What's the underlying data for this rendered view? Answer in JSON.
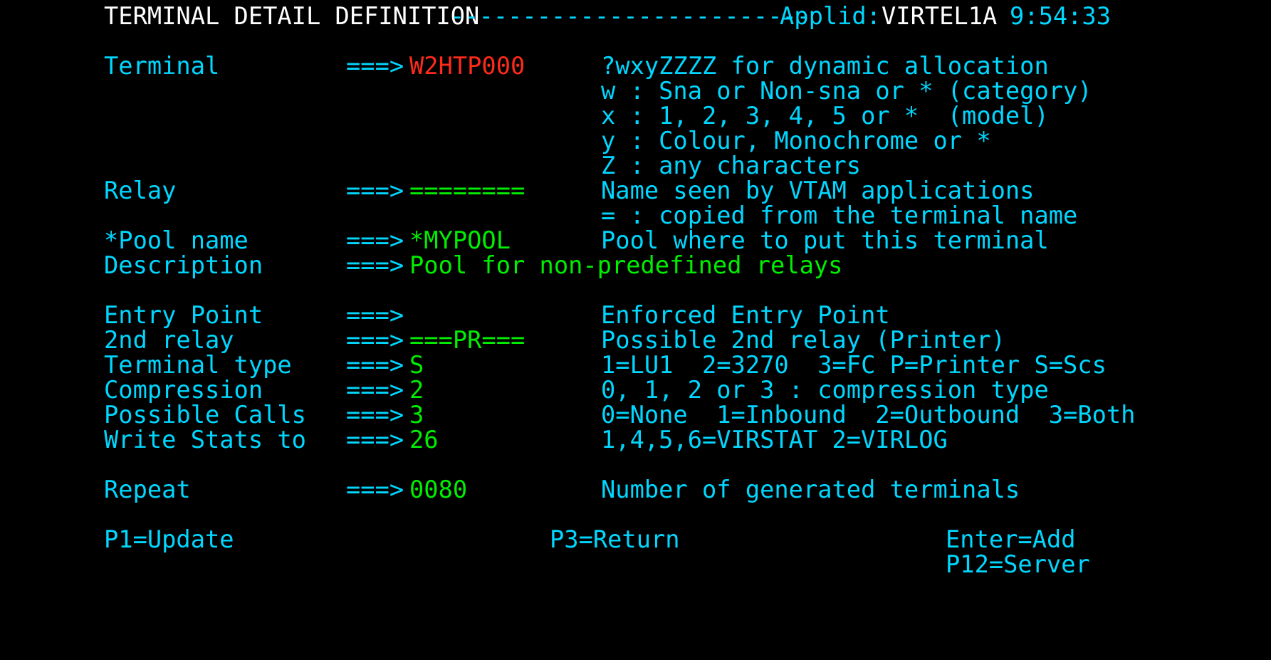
{
  "header": {
    "title": "TERMINAL DETAIL DEFINITION",
    "dashes": "-------------------------",
    "applid_label": "Applid:",
    "applid_value": "VIRTEL1A",
    "time": "9:54:33"
  },
  "arrow": "===>",
  "fields": {
    "terminal": {
      "label": "Terminal",
      "value": "W2HTP000",
      "help": [
        "?wxyZZZZ for dynamic allocation",
        "w : Sna or Non-sna or * (category)",
        "x : 1, 2, 3, 4, 5 or *  (model)",
        "y : Colour, Monochrome or *",
        "Z : any characters"
      ]
    },
    "relay": {
      "label": "Relay",
      "value": "========",
      "help": [
        "Name seen by VTAM applications",
        "= : copied from the terminal name"
      ]
    },
    "pool_name": {
      "label": "*Pool name",
      "value": "*MYPOOL",
      "help": "Pool where to put this terminal"
    },
    "description": {
      "label": "Description",
      "value": "Pool for non-predefined relays"
    },
    "entry_point": {
      "label": "Entry Point",
      "value": "",
      "help": "Enforced Entry Point"
    },
    "second_relay": {
      "label": "2nd relay",
      "value": "===PR===",
      "help": "Possible 2nd relay (Printer)"
    },
    "terminal_type": {
      "label": "Terminal type",
      "value": "S",
      "help": "1=LU1  2=3270  3=FC P=Printer S=Scs"
    },
    "compression": {
      "label": "Compression",
      "value": "2",
      "help": "0, 1, 2 or 3 : compression type"
    },
    "possible_calls": {
      "label": "Possible Calls",
      "value": "3",
      "help": "0=None  1=Inbound  2=Outbound  3=Both"
    },
    "write_stats": {
      "label": "Write Stats to",
      "value": "26",
      "help": "1,4,5,6=VIRSTAT 2=VIRLOG"
    },
    "repeat": {
      "label": "Repeat",
      "value": "0080",
      "help": "Number of generated terminals"
    }
  },
  "function_keys": {
    "update": "P1=Update",
    "return": "P3=Return",
    "add": "Enter=Add",
    "server": "P12=Server"
  },
  "colors": {
    "background": "#000000",
    "label": "#00d7ff",
    "input": "#00ee00",
    "error_input": "#ff2a1a",
    "title": "#ffffff"
  }
}
